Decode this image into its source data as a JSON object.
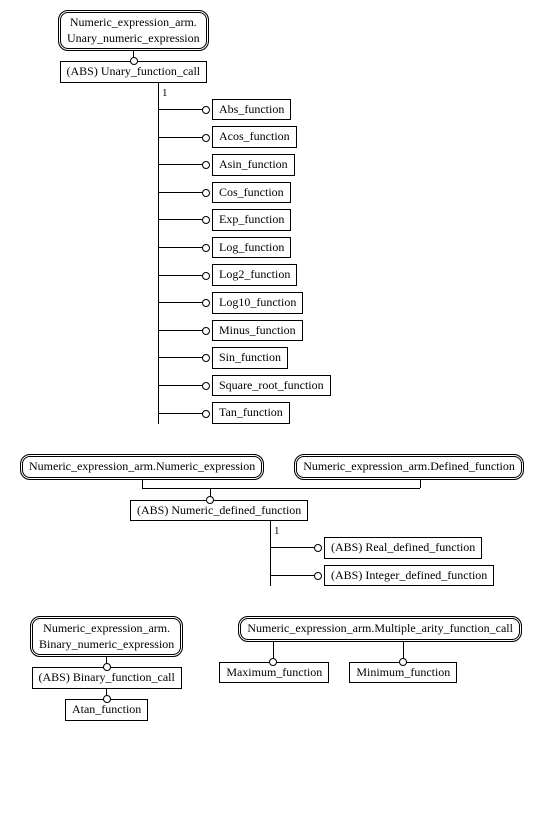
{
  "section1": {
    "root": "Numeric_expression_arm.\nUnary_numeric_expression",
    "child": "(ABS) Unary_function_call",
    "one": "1",
    "leaves": [
      "Abs_function",
      "Acos_function",
      "Asin_function",
      "Cos_function",
      "Exp_function",
      "Log_function",
      "Log2_function",
      "Log10_function",
      "Minus_function",
      "Sin_function",
      "Square_root_function",
      "Tan_function"
    ]
  },
  "section2": {
    "parent_left": "Numeric_expression_arm.Numeric_expression",
    "parent_right": "Numeric_expression_arm.Defined_function",
    "child": "(ABS) Numeric_defined_function",
    "one": "1",
    "leaves": [
      "(ABS) Real_defined_function",
      "(ABS) Integer_defined_function"
    ]
  },
  "section3": {
    "root": "Numeric_expression_arm.\nBinary_numeric_expression",
    "child": "(ABS) Binary_function_call",
    "leaf": "Atan_function"
  },
  "section4": {
    "root": "Numeric_expression_arm.Multiple_arity_function_call",
    "leaves": [
      "Maximum_function",
      "Minimum_function"
    ]
  }
}
